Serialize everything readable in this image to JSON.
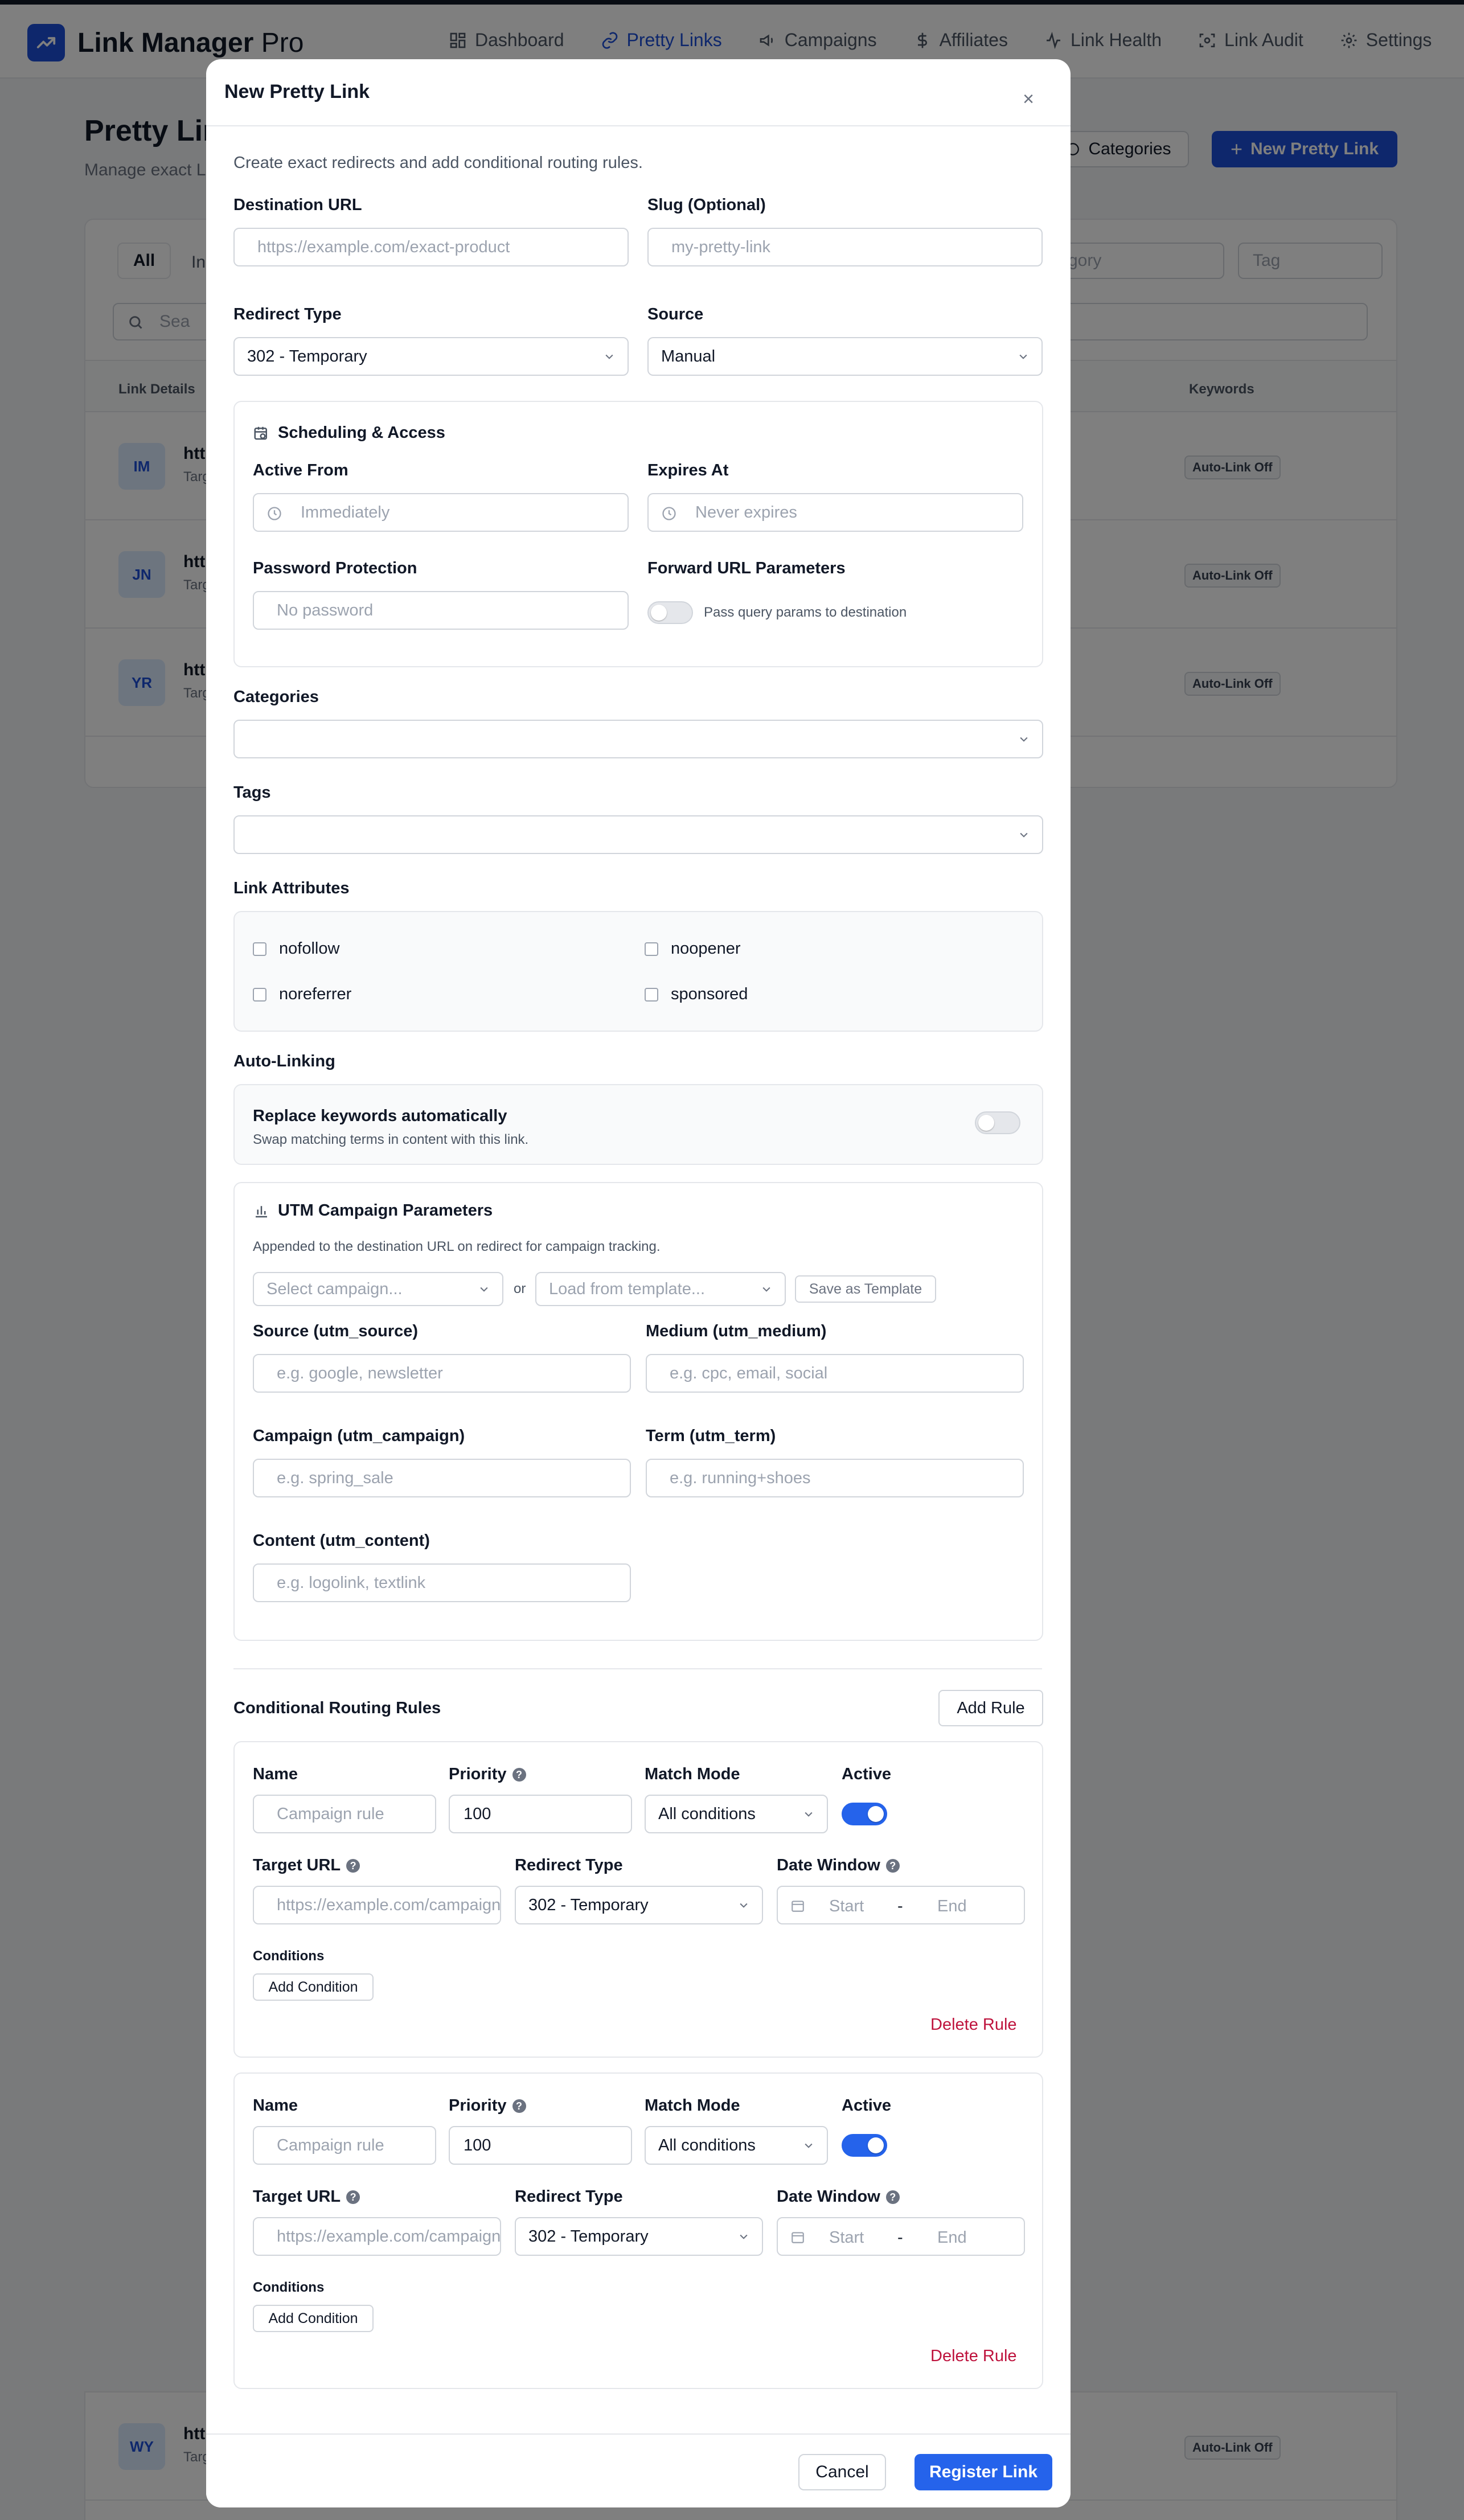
{
  "app": {
    "name": "Link Manager",
    "name_suffix": "Pro",
    "nav": [
      {
        "label": "Dashboard",
        "icon": "dashboard-icon"
      },
      {
        "label": "Pretty Links",
        "icon": "link-icon",
        "active": true
      },
      {
        "label": "Campaigns",
        "icon": "megaphone-icon"
      },
      {
        "label": "Affiliates",
        "icon": "dollar-icon"
      },
      {
        "label": "Link Health",
        "icon": "activity-icon"
      },
      {
        "label": "Link Audit",
        "icon": "audit-icon"
      },
      {
        "label": "Settings",
        "icon": "gear-icon"
      }
    ]
  },
  "page": {
    "title": "Pretty Lin",
    "subtitle": "Manage exact L",
    "categories_button": "Categories",
    "new_button": "New Pretty Link"
  },
  "list": {
    "tab_all": "All",
    "tab_in": "In",
    "filter_category": "gory",
    "filter_tag": "Tag",
    "search_placeholder": "Sea",
    "col_link_details": "Link Details",
    "col_keywords": "Keywords",
    "rows": [
      {
        "initials": "IM",
        "url": "http",
        "target": "Targ",
        "badge": "Auto-Link Off"
      },
      {
        "initials": "JN",
        "url": "http",
        "target": "Targ",
        "badge": "Auto-Link Off"
      },
      {
        "initials": "YR",
        "url": "http",
        "target": "Targ",
        "badge": "Auto-Link Off"
      },
      {
        "initials": "WY",
        "url": "http",
        "target": "Targ",
        "badge": "Auto-Link Off"
      }
    ]
  },
  "modal": {
    "title": "New Pretty Link",
    "intro": "Create exact redirects and add conditional routing rules.",
    "destination_label": "Destination URL",
    "destination_placeholder": "https://example.com/exact-product",
    "slug_label": "Slug (Optional)",
    "slug_placeholder": "my-pretty-link",
    "redirect_type_label": "Redirect Type",
    "redirect_type_value": "302 - Temporary",
    "source_label": "Source",
    "source_value": "Manual",
    "scheduling": {
      "title": "Scheduling & Access",
      "active_from_label": "Active From",
      "active_from_placeholder": "Immediately",
      "expires_label": "Expires At",
      "expires_placeholder": "Never expires",
      "password_label": "Password Protection",
      "password_placeholder": "No password",
      "forward_label": "Forward URL Parameters",
      "forward_toggle_text": "Pass query params to destination",
      "forward_on": false
    },
    "categories_label": "Categories",
    "tags_label": "Tags",
    "attributes": {
      "label": "Link Attributes",
      "items": [
        "nofollow",
        "noopener",
        "noreferrer",
        "sponsored"
      ]
    },
    "autolink": {
      "label": "Auto-Linking",
      "title": "Replace keywords automatically",
      "desc": "Swap matching terms in content with this link.",
      "on": false
    },
    "utm": {
      "title": "UTM Campaign Parameters",
      "desc": "Appended to the destination URL on redirect for campaign tracking.",
      "campaign_placeholder": "Select campaign...",
      "or": "or",
      "template_placeholder": "Load from template...",
      "save_template": "Save as Template",
      "source_label": "Source (utm_source)",
      "source_placeholder": "e.g. google, newsletter",
      "medium_label": "Medium (utm_medium)",
      "medium_placeholder": "e.g. cpc, email, social",
      "campaign_label": "Campaign (utm_campaign)",
      "campaign_ph": "e.g. spring_sale",
      "term_label": "Term (utm_term)",
      "term_placeholder": "e.g. running+shoes",
      "content_label": "Content (utm_content)",
      "content_placeholder": "e.g. logolink, textlink"
    },
    "routing": {
      "title": "Conditional Routing Rules",
      "add_rule": "Add Rule",
      "rules": [
        {
          "name_label": "Name",
          "name_placeholder": "Campaign rule",
          "priority_label": "Priority",
          "priority_value": "100",
          "match_label": "Match Mode",
          "match_value": "All conditions",
          "active_label": "Active",
          "active": true,
          "target_label": "Target URL",
          "target_placeholder": "https://example.com/campaign",
          "redirect_label": "Redirect Type",
          "redirect_value": "302 - Temporary",
          "date_label": "Date Window",
          "start": "Start",
          "dash": "-",
          "end": "End",
          "conditions_label": "Conditions",
          "add_condition": "Add Condition",
          "delete": "Delete Rule"
        },
        {
          "name_label": "Name",
          "name_placeholder": "Campaign rule",
          "priority_label": "Priority",
          "priority_value": "100",
          "match_label": "Match Mode",
          "match_value": "All conditions",
          "active_label": "Active",
          "active": true,
          "target_label": "Target URL",
          "target_placeholder": "https://example.com/campaign",
          "redirect_label": "Redirect Type",
          "redirect_value": "302 - Temporary",
          "date_label": "Date Window",
          "start": "Start",
          "dash": "-",
          "end": "End",
          "conditions_label": "Conditions",
          "add_condition": "Add Condition",
          "delete": "Delete Rule"
        }
      ]
    },
    "cancel": "Cancel",
    "submit": "Register Link"
  },
  "colors": {
    "accent": "#1d4ed8",
    "danger": "#be123c",
    "toggle_on": "#2563eb"
  }
}
